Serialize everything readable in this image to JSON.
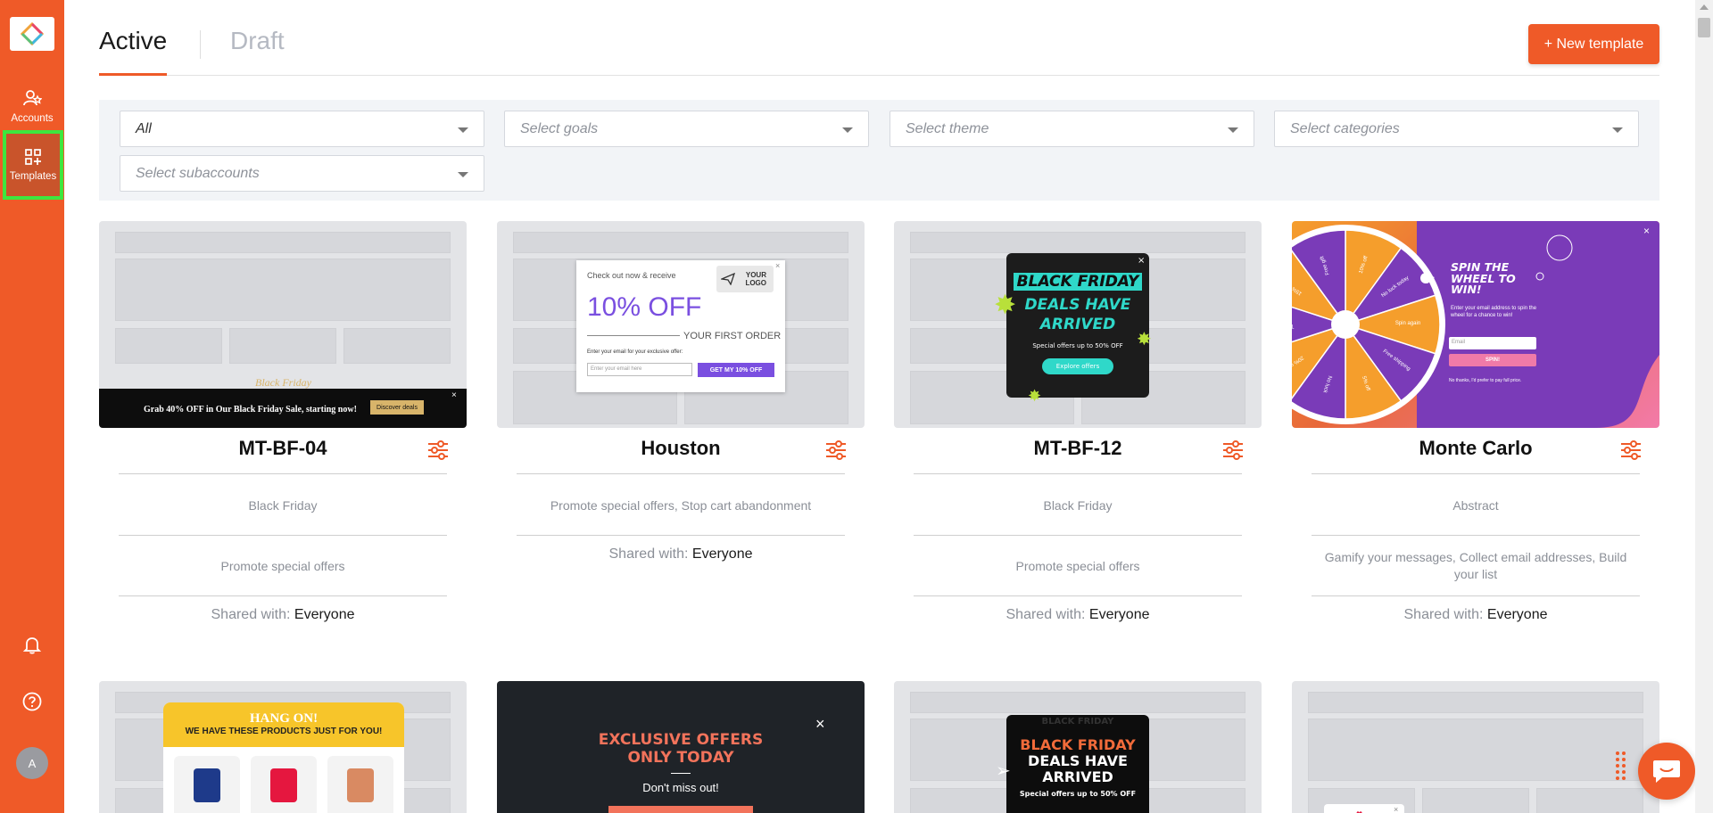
{
  "sidebar": {
    "items": [
      {
        "label": "Accounts",
        "icon": "accounts-icon"
      },
      {
        "label": "Templates",
        "icon": "templates-icon"
      }
    ],
    "avatar_initial": "A",
    "accent_color": "#ef5a28",
    "highlight_color": "#3ee63e"
  },
  "header": {
    "tabs": [
      {
        "label": "Active",
        "active": true
      },
      {
        "label": "Draft",
        "active": false
      }
    ],
    "new_button_label": "+ New template"
  },
  "filters": {
    "type": {
      "value": "All"
    },
    "goals": {
      "placeholder": "Select goals"
    },
    "theme": {
      "placeholder": "Select theme"
    },
    "categories": {
      "placeholder": "Select categories"
    },
    "subaccounts": {
      "placeholder": "Select subaccounts"
    }
  },
  "shared_label": "Shared with:",
  "cards": [
    {
      "title": "MT-BF-04",
      "theme": "Black Friday",
      "goals": "Promote special offers",
      "shared_with": "Everyone",
      "preview": {
        "brand": "Black Friday",
        "text": "Grab 40% OFF in Our Black Friday Sale, starting now!",
        "cta": "Discover deals"
      }
    },
    {
      "title": "Houston",
      "theme": "Promote special offers, Stop cart abandonment",
      "goals": "",
      "shared_with": "Everyone",
      "preview": {
        "line1": "Check out now & receive",
        "logo": "YOUR LOGO",
        "headline": "10% OFF",
        "sub": "YOUR FIRST ORDER",
        "prompt": "Enter your email for your exclusive offer:",
        "placeholder": "Enter your email here",
        "cta": "GET MY 10% OFF"
      }
    },
    {
      "title": "MT-BF-12",
      "theme": "Black Friday",
      "goals": "Promote special offers",
      "shared_with": "Everyone",
      "preview": {
        "l1": "BLACK FRIDAY",
        "l2": "DEALS HAVE",
        "l3": "ARRIVED",
        "sub": "Special offers up to 50% OFF",
        "cta": "Explore offers"
      }
    },
    {
      "title": "Monte Carlo",
      "theme": "Abstract",
      "goals": "Gamify your messages, Collect email addresses, Build your list",
      "shared_with": "Everyone",
      "preview": {
        "headline": "SPIN THE WHEEL TO WIN!",
        "text": "Enter your email address to spin the wheel for a chance to win!",
        "placeholder": "Email",
        "cta": "SPIN!",
        "decline": "No thanks, I'd prefer to pay full price.",
        "slices": [
          "10% off",
          "No luck today",
          "Spin again",
          "Free shipping",
          "5% off",
          "No luck",
          "20% off",
          "Try again",
          "15% off",
          "Free gift"
        ]
      }
    },
    {
      "title": "",
      "preview": {
        "l1": "HANG ON!",
        "l2": "WE HAVE THESE PRODUCTS JUST FOR YOU!"
      }
    },
    {
      "title": "",
      "preview": {
        "l1": "EXCLUSIVE OFFERS",
        "l2": "ONLY TODAY",
        "sub": "Don't miss out!"
      }
    },
    {
      "title": "",
      "preview": {
        "bg": "BLACK FRIDAY",
        "l1": "BLACK FRIDAY",
        "l2": "DEALS HAVE",
        "l3": "ARRIVED",
        "sub": "Special offers up to 50% OFF"
      }
    },
    {
      "title": "",
      "preview": {}
    }
  ]
}
